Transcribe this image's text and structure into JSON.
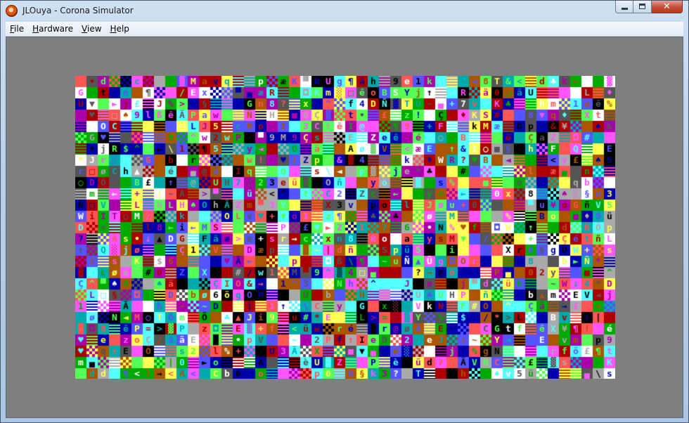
{
  "window": {
    "title": "JLOuya - Corona Simulator",
    "icon": "corona-logo-icon",
    "close_glyph": "✕"
  },
  "menu": {
    "items": [
      {
        "label": "File",
        "mnemonic": "F",
        "rest": "ile"
      },
      {
        "label": "Hardware",
        "mnemonic": "H",
        "rest": "ardware"
      },
      {
        "label": "View",
        "mnemonic": "V",
        "rest": "iew"
      },
      {
        "label": "Help",
        "mnemonic": "H",
        "rest": "elp"
      }
    ]
  },
  "simulator": {
    "content": "random-color-character-grid",
    "palette": [
      "#ff5555",
      "#55ff55",
      "#5555ff",
      "#ffff55",
      "#ff55ff",
      "#55ffff",
      "#aa0000",
      "#00aa00",
      "#0000aa",
      "#aa5500",
      "#aa00aa",
      "#00aaaa",
      "#aaaaaa",
      "#555555",
      "#ffffff",
      "#000000"
    ]
  }
}
